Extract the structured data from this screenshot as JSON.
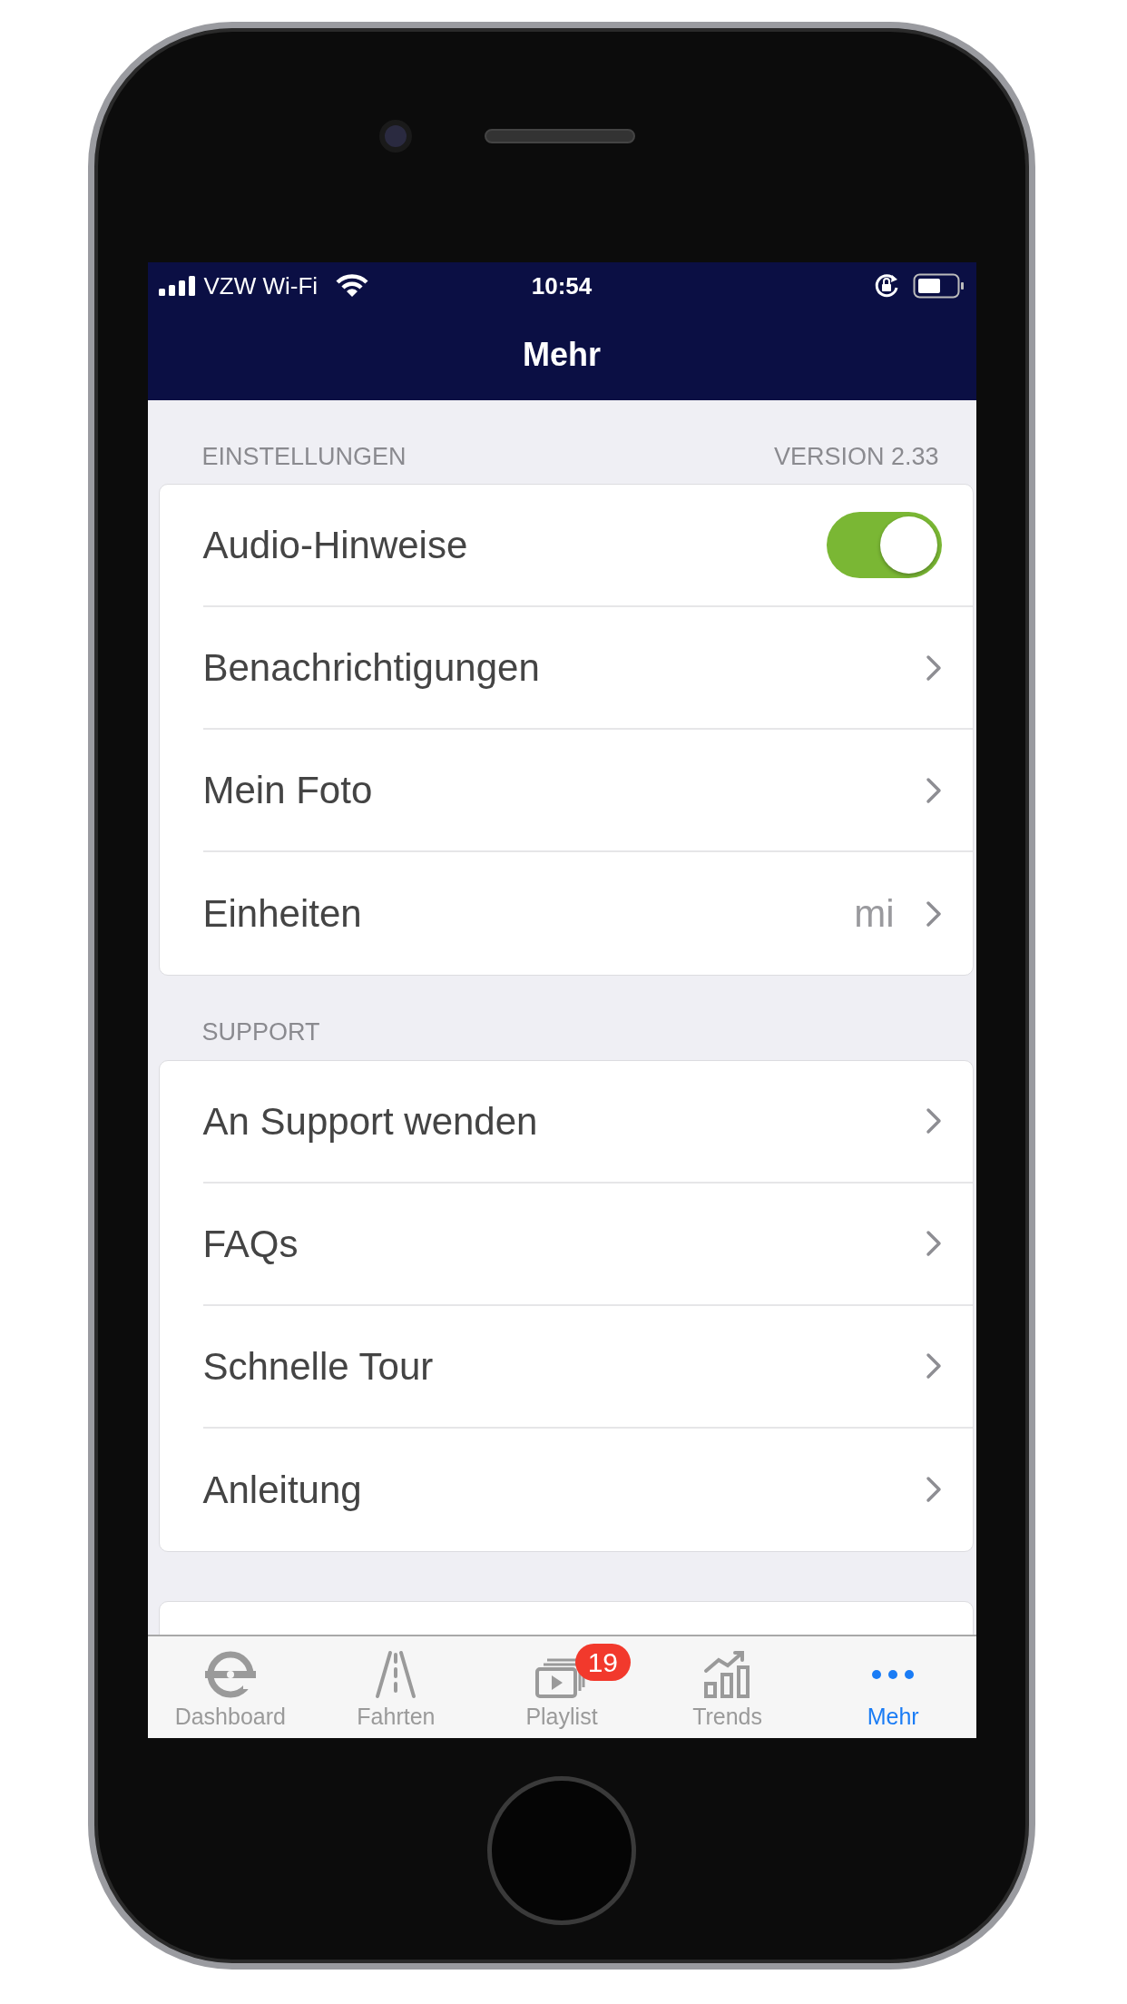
{
  "status_bar": {
    "carrier": "VZW Wi-Fi",
    "time": "10:54"
  },
  "title": "Mehr",
  "sections": [
    {
      "header": "EINSTELLUNGEN",
      "aside": "VERSION 2.33",
      "rows": [
        {
          "kind": "toggle",
          "label": "Audio-Hinweise",
          "on": true
        },
        {
          "kind": "link",
          "label": "Benachrichtigungen"
        },
        {
          "kind": "link",
          "label": "Mein Foto"
        },
        {
          "kind": "link",
          "label": "Einheiten",
          "value": "mi"
        }
      ]
    },
    {
      "header": "SUPPORT",
      "rows": [
        {
          "kind": "link",
          "label": "An Support wenden"
        },
        {
          "kind": "link",
          "label": "FAQs"
        },
        {
          "kind": "link",
          "label": "Schnelle Tour"
        },
        {
          "kind": "link",
          "label": "Anleitung"
        }
      ]
    }
  ],
  "tab_bar": [
    {
      "label": "Dashboard",
      "selected": false
    },
    {
      "label": "Fahrten",
      "selected": false
    },
    {
      "label": "Playlist",
      "selected": false,
      "badge": "19"
    },
    {
      "label": "Trends",
      "selected": false
    },
    {
      "label": "Mehr",
      "selected": true
    }
  ]
}
